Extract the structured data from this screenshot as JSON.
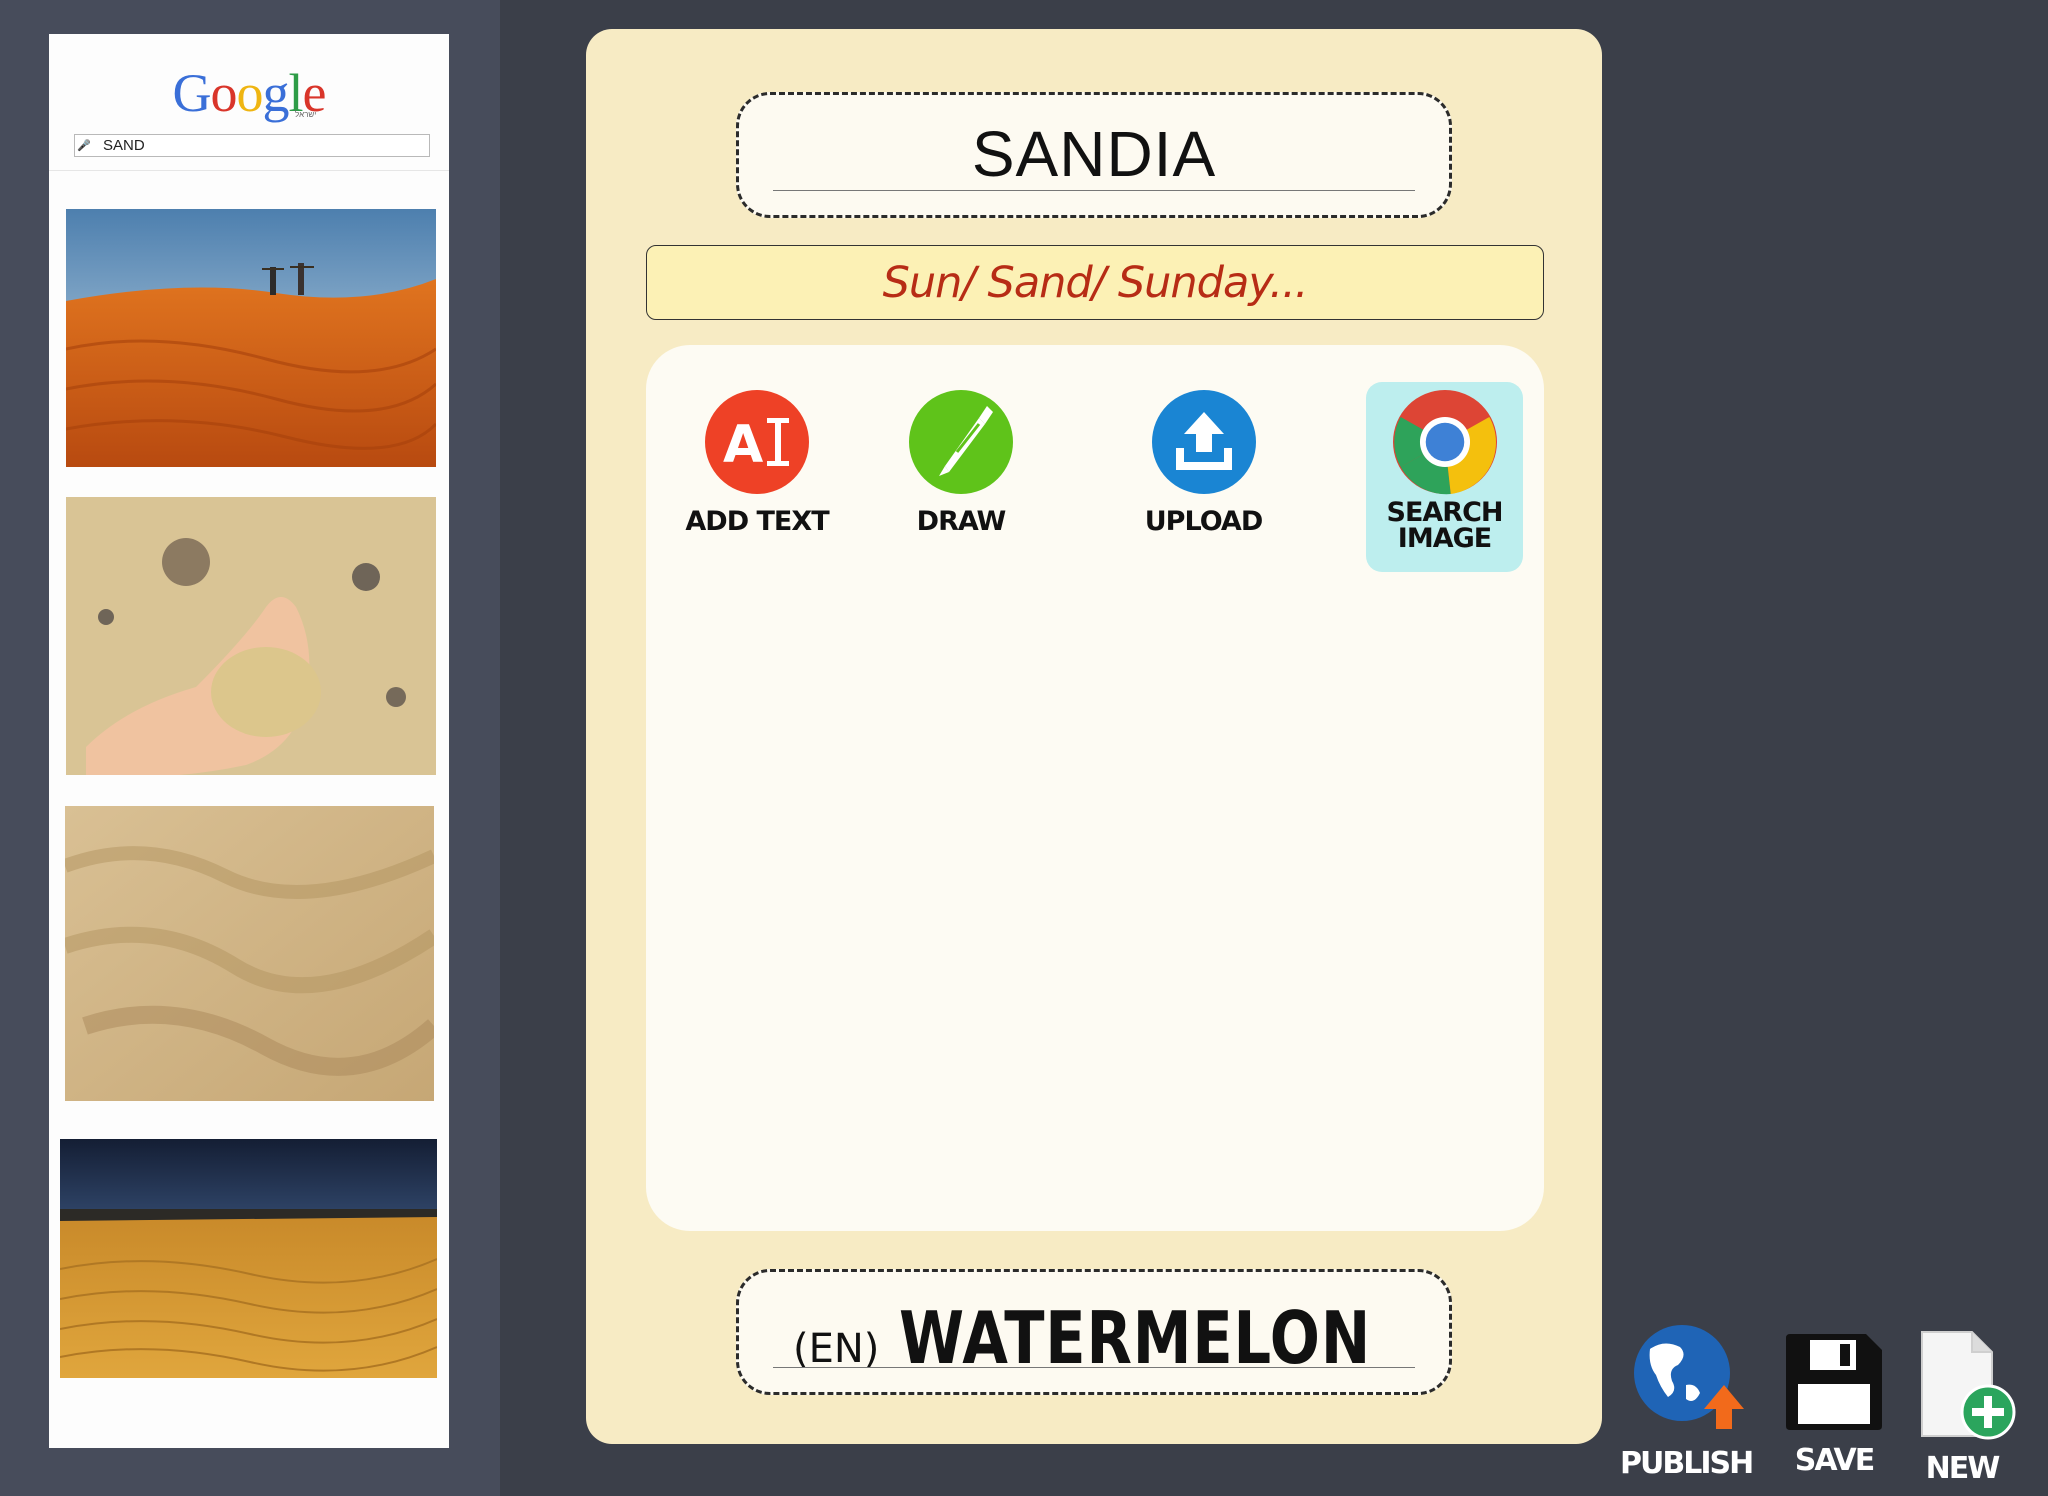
{
  "search_panel": {
    "logo_text": [
      "G",
      "o",
      "o",
      "g",
      "l",
      "e"
    ],
    "logo_sub": "ישראל",
    "query": "SAND",
    "results": [
      {
        "icon": "desert-dunes-people-image"
      },
      {
        "icon": "hand-holding-sand-image"
      },
      {
        "icon": "sand-ripples-image"
      },
      {
        "icon": "desert-stormy-sky-image"
      }
    ]
  },
  "card": {
    "word": "SANDIA",
    "hint": "Sun/ Sand/ Sunday...",
    "tools": [
      {
        "label": "ADD TEXT",
        "icon": "add-text-icon",
        "color": "#ee4126"
      },
      {
        "label": "DRAW",
        "icon": "pencil-icon",
        "color": "#5fc31a"
      },
      {
        "label": "UPLOAD",
        "icon": "upload-icon",
        "color": "#1a85d3"
      },
      {
        "label": "SEARCH",
        "label2": "IMAGE",
        "icon": "chrome-icon",
        "active": true
      }
    ],
    "translation": {
      "lang": "(EN)",
      "text": "WATERMELON"
    }
  },
  "actions": {
    "publish": "PUBLISH",
    "save": "SAVE",
    "new": "NEW"
  },
  "colors": {
    "background": "#3b3f49",
    "card": "#f7ebc4",
    "hint_text": "#b72c15",
    "active_tool": "#bdeeee"
  }
}
